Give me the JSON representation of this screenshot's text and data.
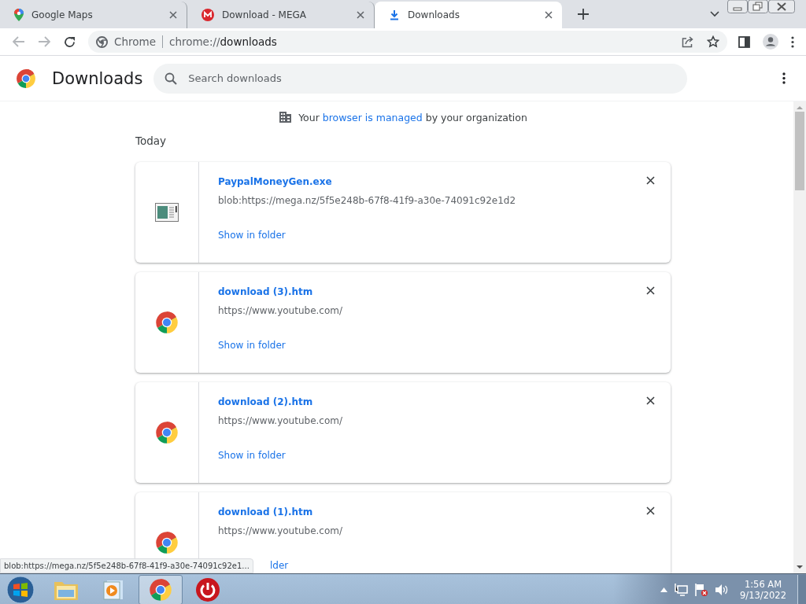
{
  "tabs": [
    {
      "title": "Google Maps",
      "kind": "maps",
      "selected": false
    },
    {
      "title": "Download - MEGA",
      "kind": "mega",
      "selected": false
    },
    {
      "title": "Downloads",
      "kind": "download",
      "selected": true
    }
  ],
  "toolbar": {
    "site_label": "Chrome",
    "url_scheme": "chrome://",
    "url_path": "downloads"
  },
  "page": {
    "title": "Downloads",
    "search": {
      "placeholder": "Search downloads"
    },
    "managed_notice": {
      "before": "Your",
      "link": "browser is managed",
      "after": "by your organization"
    },
    "date_group": "Today",
    "downloads": [
      {
        "file_name": "PaypalMoneyGen.exe",
        "url": "blob:https://mega.nz/5f5e248b-67f8-41f9-a30e-74091c92e1d2",
        "kind": "program",
        "link": "Show in folder"
      },
      {
        "file_name": "download (3).htm",
        "url": "https://www.youtube.com/",
        "kind": "chrome",
        "link": "Show in folder"
      },
      {
        "file_name": "download (2).htm",
        "url": "https://www.youtube.com/",
        "kind": "chrome",
        "link": "Show in folder"
      },
      {
        "file_name": "download (1).htm",
        "url": "https://www.youtube.com/",
        "kind": "chrome",
        "link": "lder"
      }
    ]
  },
  "status_bubble": "blob:https://mega.nz/5f5e248b-67f8-41f9-a30e-74091c92e1...",
  "taskbar": {
    "apps": [
      {
        "kind": "explorer",
        "selected": false
      },
      {
        "kind": "media",
        "selected": false
      },
      {
        "kind": "chrome",
        "selected": true
      },
      {
        "kind": "power",
        "selected": false
      }
    ],
    "clock": {
      "time": "1:56 AM",
      "date": "9/13/2022"
    }
  }
}
